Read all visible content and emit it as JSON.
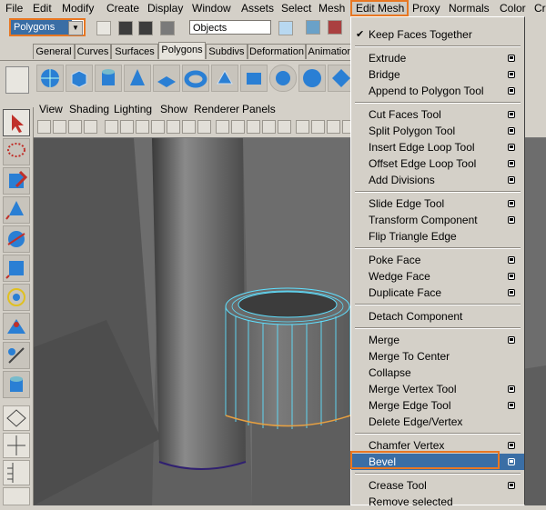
{
  "menubar": {
    "items": [
      "File",
      "Edit",
      "Modify",
      "Create",
      "Display",
      "Window",
      "Assets",
      "Select",
      "Mesh",
      "Edit Mesh",
      "Proxy",
      "Normals",
      "Color",
      "Cr"
    ]
  },
  "toolbar": {
    "mode_select": "Polygons",
    "objects_field": "Objects"
  },
  "shelf": {
    "tabs": [
      "General",
      "Curves",
      "Surfaces",
      "Polygons",
      "Subdivs",
      "Deformation",
      "Animation"
    ],
    "active_tab": "Polygons"
  },
  "panel": {
    "menu": [
      "View",
      "Shading",
      "Lighting",
      "Show",
      "Renderer",
      "Panels"
    ]
  },
  "edit_mesh_menu": {
    "items": [
      {
        "label": "Keep Faces Together",
        "checked": true
      },
      {
        "label": "Extrude"
      },
      {
        "label": "Bridge"
      },
      {
        "label": "Append to Polygon Tool"
      },
      {
        "label": "Cut Faces Tool"
      },
      {
        "label": "Split Polygon Tool"
      },
      {
        "label": "Insert Edge Loop Tool"
      },
      {
        "label": "Offset Edge Loop Tool"
      },
      {
        "label": "Add Divisions"
      },
      {
        "label": "Slide Edge Tool"
      },
      {
        "label": "Transform Component"
      },
      {
        "label": "Flip Triangle Edge"
      },
      {
        "label": "Poke Face"
      },
      {
        "label": "Wedge Face"
      },
      {
        "label": "Duplicate Face"
      },
      {
        "label": "Detach Component"
      },
      {
        "label": "Merge"
      },
      {
        "label": "Merge To Center"
      },
      {
        "label": "Collapse"
      },
      {
        "label": "Merge Vertex Tool"
      },
      {
        "label": "Merge Edge Tool"
      },
      {
        "label": "Delete Edge/Vertex"
      },
      {
        "label": "Chamfer Vertex"
      },
      {
        "label": "Bevel",
        "highlighted": true
      },
      {
        "label": "Crease Tool"
      },
      {
        "label": "Remove selected"
      }
    ]
  },
  "colors": {
    "highlight_outline": "#e87722",
    "selection_blue": "#3a6ea5",
    "ui_gray": "#d4d0c8",
    "viewport_gray": "#6a6a6a",
    "wireframe_cyan": "#5fe0ff"
  }
}
